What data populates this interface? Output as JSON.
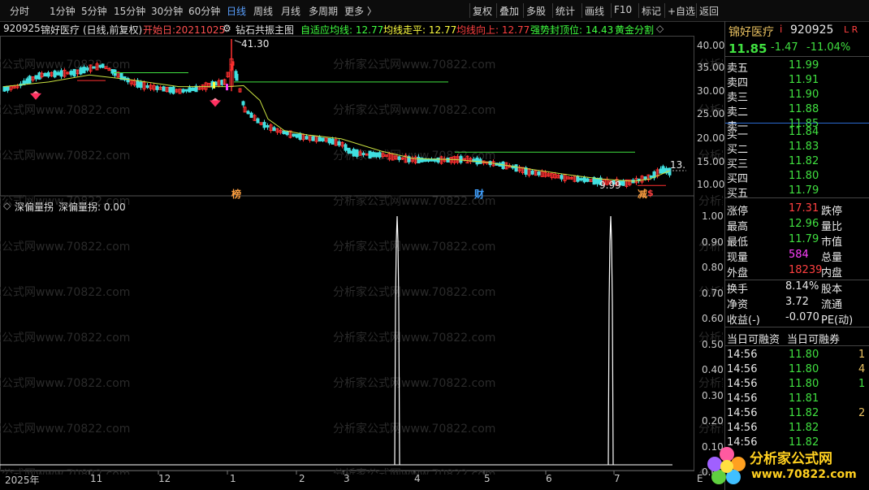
{
  "toolbar": {
    "left_items": [
      "分时",
      "1分钟",
      "5分钟",
      "15分钟",
      "30分钟",
      "60分钟",
      "日线",
      "周线",
      "月线",
      "多周期",
      "更多 〉"
    ],
    "active": "日线",
    "right_items": [
      "复权",
      "叠加",
      "多股",
      "统计",
      "画线",
      "F10",
      "标记",
      "+自选",
      "返回"
    ]
  },
  "info": {
    "code": "920925",
    "name": "锦好医疗",
    "mode": "(日线,前复权)",
    "start": "开始日:20211025",
    "indicator": "钻石共振主图",
    "adaptive": "自适应均线: 12.77",
    "flat": "均线走平: 12.77",
    "up": "均线向上: 12.77",
    "strong": "强势封顶位: 14.43",
    "gold": "黄金分割",
    "diamond_icon": "diamond-icon"
  },
  "price_axis": [
    "40.00",
    "35.00",
    "30.00",
    "25.00",
    "20.00",
    "15.00",
    "10.00"
  ],
  "price_annotations": {
    "high": "41.30",
    "low": "9.99",
    "last": "13."
  },
  "markers": {
    "bang": "榜",
    "cai": "财",
    "jian": "减",
    "dollar": "$"
  },
  "indicator_panel": {
    "title": "深偏量拐",
    "value_label": "深偏量拐: 0.00",
    "axis": [
      "1.00",
      "0.90",
      "0.80",
      "0.70",
      "0.60",
      "0.50",
      "0.40",
      "0.30",
      "0.20",
      "0.10",
      "0.00"
    ]
  },
  "time_axis": [
    "2025年",
    "11",
    "12",
    "1",
    "2",
    "3",
    "4",
    "5",
    "6",
    "7",
    "E"
  ],
  "watermark": "分析家公式网www.70822.com",
  "quote": {
    "name": "锦好医疗",
    "code": "920925",
    "flags": "L R",
    "price": "11.85",
    "change": "-1.47",
    "pct": "-11.04%",
    "asks": [
      {
        "label": "卖五",
        "price": "11.99"
      },
      {
        "label": "卖四",
        "price": "11.91"
      },
      {
        "label": "卖三",
        "price": "11.90"
      },
      {
        "label": "卖二",
        "price": "11.88"
      },
      {
        "label": "卖一",
        "price": "11.85"
      }
    ],
    "bids": [
      {
        "label": "买一",
        "price": "11.84"
      },
      {
        "label": "买二",
        "price": "11.83"
      },
      {
        "label": "买三",
        "price": "11.82"
      },
      {
        "label": "买四",
        "price": "11.80"
      },
      {
        "label": "买五",
        "price": "11.79"
      }
    ],
    "stats": [
      {
        "k1": "涨停",
        "v1": "17.31",
        "k2": "跌停",
        "c": "red"
      },
      {
        "k1": "最高",
        "v1": "12.96",
        "k2": "量比",
        "c": "green"
      },
      {
        "k1": "最低",
        "v1": "11.79",
        "k2": "市值",
        "c": "green"
      },
      {
        "k1": "现量",
        "v1": "584",
        "k2": "总量",
        "c": "magenta"
      },
      {
        "k1": "外盘",
        "v1": "18239",
        "k2": "内盘",
        "c": "red"
      }
    ],
    "stats2": [
      {
        "k1": "换手",
        "v1": "8.14%",
        "k2": "股本"
      },
      {
        "k1": "净资",
        "v1": "3.72",
        "k2": "流通"
      },
      {
        "k1": "收益(-)",
        "v1": "-0.070",
        "k2": "PE(动)"
      }
    ],
    "margin": {
      "a": "当日可融资",
      "b": "当日可融券"
    },
    "ticks": [
      {
        "t": "14:56",
        "p": "11.80",
        "v": "1",
        "c": "green"
      },
      {
        "t": "14:56",
        "p": "11.80",
        "v": "4",
        "c": "green"
      },
      {
        "t": "14:56",
        "p": "11.80",
        "v": "1",
        "c": "green"
      },
      {
        "t": "14:56",
        "p": "11.81",
        "v": "",
        "c": "green"
      },
      {
        "t": "14:56",
        "p": "11.82",
        "v": "2",
        "c": "green"
      },
      {
        "t": "14:56",
        "p": "11.82",
        "v": "",
        "c": "green"
      },
      {
        "t": "14:56",
        "p": "11.82",
        "v": "",
        "c": "green"
      }
    ]
  },
  "logo": {
    "title": "分析家公式网",
    "url": "www.70822.com"
  }
}
